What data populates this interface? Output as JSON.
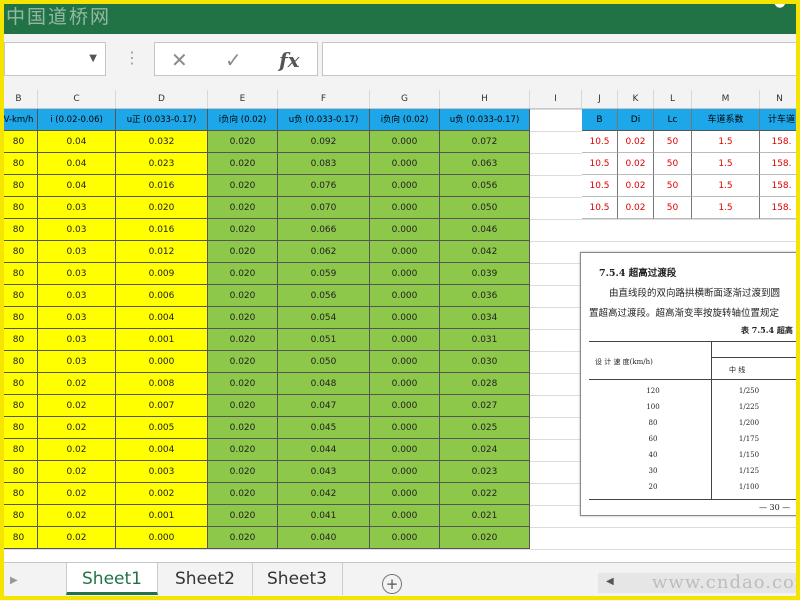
{
  "watermark_top": "中国道桥网",
  "ribbon_tabs": [
    "",
    "",
    "",
    "",
    "",
    "",
    "",
    ""
  ],
  "account_label": "",
  "formula_bar": {
    "name_box": "",
    "cancel_icon": "✕",
    "enter_icon": "✓",
    "fx_label": "fx",
    "value": ""
  },
  "columns": [
    "B",
    "C",
    "D",
    "E",
    "F",
    "G",
    "H",
    "I",
    "J",
    "K",
    "L",
    "M",
    "N"
  ],
  "main_headers": [
    "V-km/h",
    "i (0.02-0.06)",
    "u正 (0.033-0.17)",
    "i负向 (0.02)",
    "u负 (0.033-0.17)",
    "i负向 (0.02)",
    "u负 (0.033-0.17)"
  ],
  "main_rows": [
    [
      "80",
      "0.04",
      "0.032",
      "0.020",
      "0.092",
      "0.000",
      "0.072"
    ],
    [
      "80",
      "0.04",
      "0.023",
      "0.020",
      "0.083",
      "0.000",
      "0.063"
    ],
    [
      "80",
      "0.04",
      "0.016",
      "0.020",
      "0.076",
      "0.000",
      "0.056"
    ],
    [
      "80",
      "0.03",
      "0.020",
      "0.020",
      "0.070",
      "0.000",
      "0.050"
    ],
    [
      "80",
      "0.03",
      "0.016",
      "0.020",
      "0.066",
      "0.000",
      "0.046"
    ],
    [
      "80",
      "0.03",
      "0.012",
      "0.020",
      "0.062",
      "0.000",
      "0.042"
    ],
    [
      "80",
      "0.03",
      "0.009",
      "0.020",
      "0.059",
      "0.000",
      "0.039"
    ],
    [
      "80",
      "0.03",
      "0.006",
      "0.020",
      "0.056",
      "0.000",
      "0.036"
    ],
    [
      "80",
      "0.03",
      "0.004",
      "0.020",
      "0.054",
      "0.000",
      "0.034"
    ],
    [
      "80",
      "0.03",
      "0.001",
      "0.020",
      "0.051",
      "0.000",
      "0.031"
    ],
    [
      "80",
      "0.03",
      "0.000",
      "0.020",
      "0.050",
      "0.000",
      "0.030"
    ],
    [
      "80",
      "0.02",
      "0.008",
      "0.020",
      "0.048",
      "0.000",
      "0.028"
    ],
    [
      "80",
      "0.02",
      "0.007",
      "0.020",
      "0.047",
      "0.000",
      "0.027"
    ],
    [
      "80",
      "0.02",
      "0.005",
      "0.020",
      "0.045",
      "0.000",
      "0.025"
    ],
    [
      "80",
      "0.02",
      "0.004",
      "0.020",
      "0.044",
      "0.000",
      "0.024"
    ],
    [
      "80",
      "0.02",
      "0.003",
      "0.020",
      "0.043",
      "0.000",
      "0.023"
    ],
    [
      "80",
      "0.02",
      "0.002",
      "0.020",
      "0.042",
      "0.000",
      "0.022"
    ],
    [
      "80",
      "0.02",
      "0.001",
      "0.020",
      "0.041",
      "0.000",
      "0.021"
    ],
    [
      "80",
      "0.02",
      "0.000",
      "0.020",
      "0.040",
      "0.000",
      "0.020"
    ]
  ],
  "right_headers": [
    "B",
    "Di",
    "Lc",
    "车道系数",
    "计车道"
  ],
  "right_rows": [
    [
      "10.5",
      "0.02",
      "50",
      "1.5",
      "158."
    ],
    [
      "10.5",
      "0.02",
      "50",
      "1.5",
      "158."
    ],
    [
      "10.5",
      "0.02",
      "50",
      "1.5",
      "158."
    ],
    [
      "10.5",
      "0.02",
      "50",
      "1.5",
      "158."
    ]
  ],
  "doc": {
    "heading": "7.5.4  超高过渡段",
    "para1": "由直线段的双向路拱横断面逐渐过渡到圆",
    "para2": "置超高过渡段。超高渐变率按旋转轴位置规定",
    "caption": "表 7.5.4  超高",
    "col_speed": "设 计 速 度(km/h)",
    "col_center": "中  线",
    "rows": [
      [
        "120",
        "1/250"
      ],
      [
        "100",
        "1/225"
      ],
      [
        "80",
        "1/200"
      ],
      [
        "60",
        "1/175"
      ],
      [
        "40",
        "1/150"
      ],
      [
        "30",
        "1/125"
      ],
      [
        "20",
        "1/100"
      ]
    ],
    "page": "— 30 —"
  },
  "sheets": [
    "Sheet1",
    "Sheet2",
    "Sheet3"
  ],
  "active_sheet": "Sheet1",
  "add_sheet": "+",
  "watermark_bottom": "www.cndao.com",
  "colors": {
    "accent": "#217346",
    "header_blue": "#1ea7e8",
    "yellow": "#ffff00",
    "green": "#8dc84a",
    "red_text": "#e00000"
  }
}
